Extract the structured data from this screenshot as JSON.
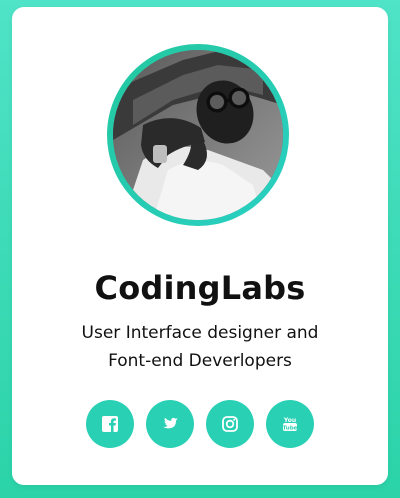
{
  "profile": {
    "name": "CodingLabs",
    "description_line1": "User Interface designer and",
    "description_line2": "Font-end Deverlopers"
  },
  "socials": [
    {
      "icon": "facebook-icon"
    },
    {
      "icon": "twitter-icon"
    },
    {
      "icon": "instagram-icon"
    },
    {
      "icon": "youtube-icon"
    }
  ],
  "colors": {
    "background_top": "#4fe3c7",
    "background_bottom": "#2bd3a8",
    "accent": "#2ad0b4",
    "card": "#ffffff",
    "text": "#111111"
  }
}
